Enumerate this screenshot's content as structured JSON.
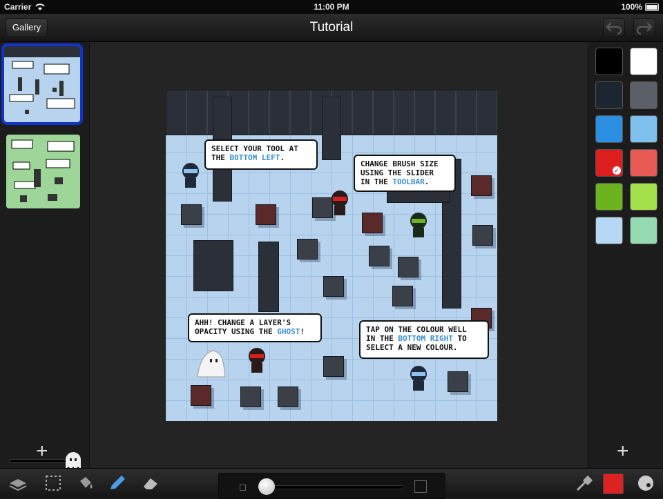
{
  "status_bar": {
    "carrier": "Carrier",
    "time": "11:00 PM",
    "battery": "100%"
  },
  "nav": {
    "title": "Tutorial",
    "gallery_label": "Gallery"
  },
  "layers": {
    "thumbnails": [
      {
        "name": "layer-1",
        "selected": true,
        "bg": "#b7d3ee"
      },
      {
        "name": "layer-2",
        "selected": false,
        "bg": "#9ed69a"
      }
    ],
    "add_label": "+"
  },
  "palette": {
    "add_label": "+",
    "swatches": [
      "#000000",
      "#ffffff",
      "#1d2530",
      "#5b6068",
      "#2a8fe0",
      "#80c0ee",
      "#dd1f1f",
      "#e85b55",
      "#6cb31f",
      "#a2df4a",
      "#b7d8f4",
      "#95dab0"
    ],
    "selected_index": 6
  },
  "canvas": {
    "bubbles": [
      {
        "parts": [
          "SELECT YOUR TOOL AT\nTHE ",
          "BOTTOM LEFT",
          "."
        ]
      },
      {
        "parts": [
          "CHANGE BRUSH SIZE\nUSING THE SLIDER\nIN THE ",
          "TOOLBAR",
          "."
        ]
      },
      {
        "parts": [
          "AHH! CHANGE A LAYER'S\nOPACITY USING THE ",
          "GHOST",
          "!"
        ]
      },
      {
        "parts": [
          "TAP ON THE COLOUR WELL\nIN THE ",
          "BOTTOM RIGHT",
          " TO\nSELECT A NEW COLOUR."
        ]
      }
    ]
  },
  "toolbar": {
    "tools": [
      "layers-icon",
      "selection-icon",
      "fill-bucket-icon",
      "pencil-icon",
      "eraser-icon"
    ],
    "active_tool": "pencil-icon",
    "brush_size_fraction": 0.0,
    "current_color": "#dd2222"
  }
}
